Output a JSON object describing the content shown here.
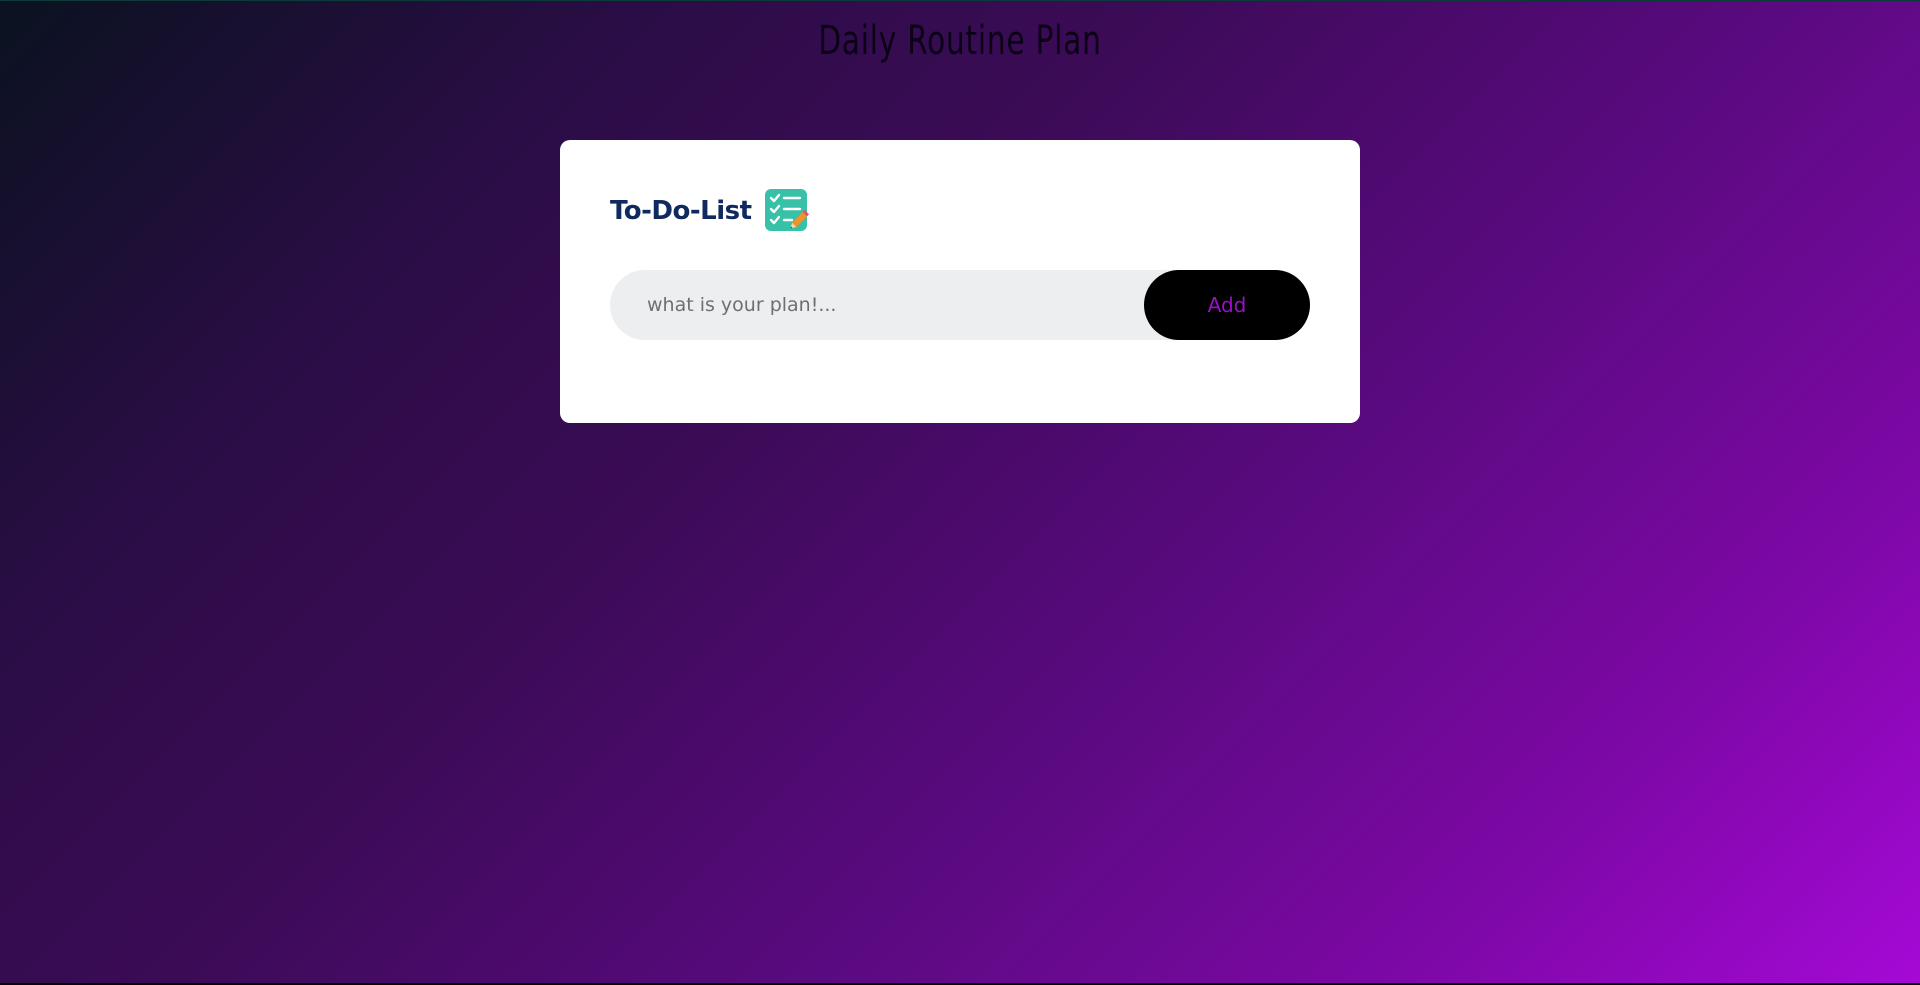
{
  "page": {
    "title": "Daily Routine Plan"
  },
  "card": {
    "title": "To-Do-List",
    "icon": "checklist-pencil-icon"
  },
  "input": {
    "placeholder": "what is your plan!...",
    "value": ""
  },
  "add_button": {
    "label": "Add"
  },
  "colors": {
    "background_start": "#0a1220",
    "background_end": "#a509d6",
    "card_title": "#102a60",
    "button_bg": "#000000",
    "button_text": "#9a10c7",
    "icon_bg": "#36c1a8"
  }
}
